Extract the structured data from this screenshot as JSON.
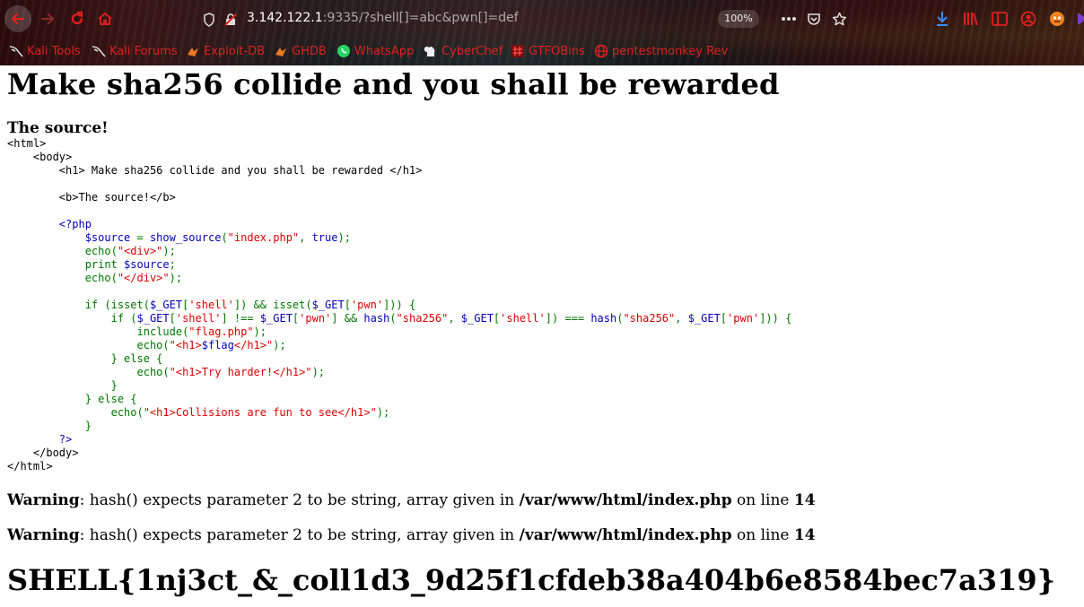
{
  "browser": {
    "url_host": "3.142.122.1",
    "url_rest": ":9335/?shell[]=abc&pwn[]=def",
    "zoom": "100%",
    "bookmarks": [
      {
        "label": "Kali Tools",
        "icon": "kali-dragon-icon"
      },
      {
        "label": "Kali Forums",
        "icon": "kali-dragon-icon"
      },
      {
        "label": "Exploit-DB",
        "icon": "exploit-db-icon"
      },
      {
        "label": "GHDB",
        "icon": "ghdb-icon"
      },
      {
        "label": "WhatsApp",
        "icon": "whatsapp-icon"
      },
      {
        "label": "CyberChef",
        "icon": "cyberchef-icon"
      },
      {
        "label": "GTFOBins",
        "icon": "gtfobins-icon"
      },
      {
        "label": "pentestmonkey Rev",
        "icon": "globe-icon"
      }
    ],
    "accent_color": "#e02020"
  },
  "page": {
    "heading": "Make sha256 collide and you shall be rewarded",
    "source_title": "The source!",
    "warnings": [
      {
        "label": "Warning",
        "message": ": hash() expects parameter 2 to be string, array given in ",
        "file": "/var/www/html/index.php",
        "on_line": " on line ",
        "line": "14"
      },
      {
        "label": "Warning",
        "message": ": hash() expects parameter 2 to be string, array given in ",
        "file": "/var/www/html/index.php",
        "on_line": " on line ",
        "line": "14"
      }
    ],
    "flag": "SHELL{1nj3ct_&_coll1d3_9d25f1cfdeb38a404b6e8584bec7a319}"
  },
  "source_code": [
    [
      [
        "h",
        "<html>"
      ]
    ],
    [
      [
        "h",
        "    <body>"
      ]
    ],
    [
      [
        "h",
        "        <h1> Make sha256 collide and you shall be rewarded </h1>"
      ]
    ],
    [
      [
        "h",
        ""
      ]
    ],
    [
      [
        "h",
        "        <b>The source!</b>"
      ]
    ],
    [
      [
        "h",
        ""
      ]
    ],
    [
      [
        "p",
        "        <?php"
      ]
    ],
    [
      [
        "p",
        "            $source "
      ],
      [
        "k",
        "= "
      ],
      [
        "p",
        "show_source"
      ],
      [
        "k",
        "("
      ],
      [
        "s",
        "\"index.php\""
      ],
      [
        "k",
        ", "
      ],
      [
        "p",
        "true"
      ],
      [
        "k",
        ");"
      ]
    ],
    [
      [
        "k",
        "            echo("
      ],
      [
        "s",
        "\"<div>\""
      ],
      [
        "k",
        ");"
      ]
    ],
    [
      [
        "k",
        "            print "
      ],
      [
        "p",
        "$source"
      ],
      [
        "k",
        ";"
      ]
    ],
    [
      [
        "k",
        "            echo("
      ],
      [
        "s",
        "\"</div>\""
      ],
      [
        "k",
        ");"
      ]
    ],
    [
      [
        "h",
        ""
      ]
    ],
    [
      [
        "k",
        "            if (isset("
      ],
      [
        "p",
        "$_GET"
      ],
      [
        "k",
        "["
      ],
      [
        "s",
        "'shell'"
      ],
      [
        "k",
        "]) && isset("
      ],
      [
        "p",
        "$_GET"
      ],
      [
        "k",
        "["
      ],
      [
        "s",
        "'pwn'"
      ],
      [
        "k",
        "])) {"
      ]
    ],
    [
      [
        "k",
        "                if ("
      ],
      [
        "p",
        "$_GET"
      ],
      [
        "k",
        "["
      ],
      [
        "s",
        "'shell'"
      ],
      [
        "k",
        "] !== "
      ],
      [
        "p",
        "$_GET"
      ],
      [
        "k",
        "["
      ],
      [
        "s",
        "'pwn'"
      ],
      [
        "k",
        "] && "
      ],
      [
        "p",
        "hash"
      ],
      [
        "k",
        "("
      ],
      [
        "s",
        "\"sha256\""
      ],
      [
        "k",
        ", "
      ],
      [
        "p",
        "$_GET"
      ],
      [
        "k",
        "["
      ],
      [
        "s",
        "'shell'"
      ],
      [
        "k",
        "]) === "
      ],
      [
        "p",
        "hash"
      ],
      [
        "k",
        "("
      ],
      [
        "s",
        "\"sha256\""
      ],
      [
        "k",
        ", "
      ],
      [
        "p",
        "$_GET"
      ],
      [
        "k",
        "["
      ],
      [
        "s",
        "'pwn'"
      ],
      [
        "k",
        "])) {"
      ]
    ],
    [
      [
        "k",
        "                    include("
      ],
      [
        "s",
        "\"flag.php\""
      ],
      [
        "k",
        ");"
      ]
    ],
    [
      [
        "k",
        "                    echo("
      ],
      [
        "s",
        "\"<h1>"
      ],
      [
        "p",
        "$flag"
      ],
      [
        "s",
        "</h1>\""
      ],
      [
        "k",
        ");"
      ]
    ],
    [
      [
        "k",
        "                } else {"
      ]
    ],
    [
      [
        "k",
        "                    echo("
      ],
      [
        "s",
        "\"<h1>Try harder!</h1>\""
      ],
      [
        "k",
        ");"
      ]
    ],
    [
      [
        "k",
        "                }"
      ]
    ],
    [
      [
        "k",
        "            } else {"
      ]
    ],
    [
      [
        "k",
        "                echo("
      ],
      [
        "s",
        "\"<h1>Collisions are fun to see</h1>\""
      ],
      [
        "k",
        ");"
      ]
    ],
    [
      [
        "k",
        "            }"
      ]
    ],
    [
      [
        "p",
        "        ?>"
      ]
    ],
    [
      [
        "h",
        "    </body>"
      ]
    ],
    [
      [
        "h",
        "</html>"
      ]
    ]
  ]
}
